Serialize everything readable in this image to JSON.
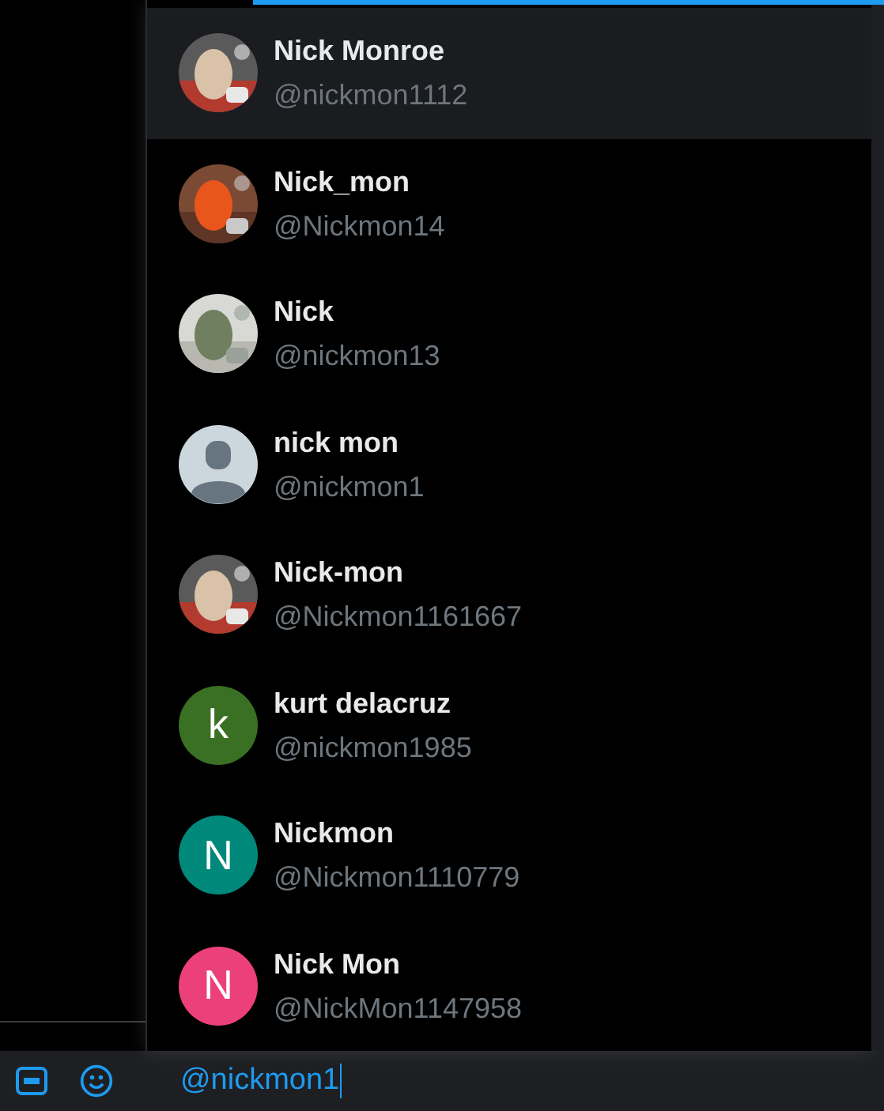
{
  "suggestions": [
    {
      "name": "Nick Monroe",
      "handle": "@nickmon1112",
      "selected": true
    },
    {
      "name": "Nick_mon",
      "handle": "@Nickmon14",
      "selected": false
    },
    {
      "name": "Nick",
      "handle": "@nickmon13",
      "selected": false
    },
    {
      "name": "nick mon",
      "handle": "@nickmon1",
      "selected": false,
      "avatar": {
        "kind": "default"
      }
    },
    {
      "name": "Nick-mon",
      "handle": "@Nickmon1161667",
      "selected": false
    },
    {
      "name": "kurt delacruz",
      "handle": "@nickmon1985",
      "selected": false,
      "avatar": {
        "kind": "letter",
        "letter": "k",
        "color": "#3a7023"
      }
    },
    {
      "name": "Nickmon",
      "handle": "@Nickmon1110779",
      "selected": false,
      "avatar": {
        "kind": "letter",
        "letter": "N",
        "color": "#00897b"
      }
    },
    {
      "name": "Nick Mon",
      "handle": "@NickMon1147958",
      "selected": false,
      "avatar": {
        "kind": "letter",
        "letter": "N",
        "color": "#ec407a"
      }
    }
  ],
  "composer": {
    "value": "@nickmon1"
  }
}
